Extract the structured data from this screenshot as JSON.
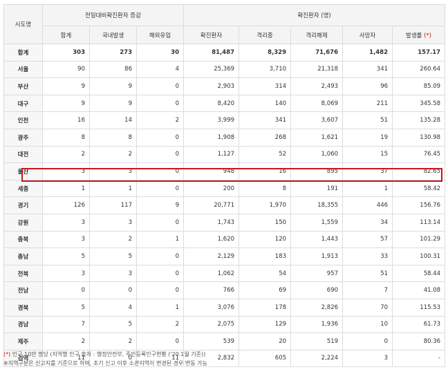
{
  "headers": {
    "region": "시도명",
    "group_daily": "전일대비확진환자 증감",
    "group_confirmed": "확진환자 (명)",
    "sub": [
      "합계",
      "국내발생",
      "해외유입",
      "확진환자",
      "격리중",
      "격리해제",
      "사망자",
      "발생률"
    ],
    "rate_mark": "(*)"
  },
  "rows": [
    {
      "region": "합계",
      "total": "303",
      "domestic": "273",
      "overseas": "30",
      "confirmed": "81,487",
      "isolated": "8,329",
      "released": "71,676",
      "deaths": "1,482",
      "rate": "157.17"
    },
    {
      "region": "서울",
      "total": "90",
      "domestic": "86",
      "overseas": "4",
      "confirmed": "25,369",
      "isolated": "3,710",
      "released": "21,318",
      "deaths": "341",
      "rate": "260.64"
    },
    {
      "region": "부산",
      "total": "9",
      "domestic": "9",
      "overseas": "0",
      "confirmed": "2,903",
      "isolated": "314",
      "released": "2,493",
      "deaths": "96",
      "rate": "85.09"
    },
    {
      "region": "대구",
      "total": "9",
      "domestic": "9",
      "overseas": "0",
      "confirmed": "8,420",
      "isolated": "140",
      "released": "8,069",
      "deaths": "211",
      "rate": "345.58"
    },
    {
      "region": "인천",
      "total": "16",
      "domestic": "14",
      "overseas": "2",
      "confirmed": "3,999",
      "isolated": "341",
      "released": "3,607",
      "deaths": "51",
      "rate": "135.28"
    },
    {
      "region": "광주",
      "total": "8",
      "domestic": "8",
      "overseas": "0",
      "confirmed": "1,908",
      "isolated": "268",
      "released": "1,621",
      "deaths": "19",
      "rate": "130.98"
    },
    {
      "region": "대전",
      "total": "2",
      "domestic": "2",
      "overseas": "0",
      "confirmed": "1,127",
      "isolated": "52",
      "released": "1,060",
      "deaths": "15",
      "rate": "76.45"
    },
    {
      "region": "울산",
      "total": "3",
      "domestic": "3",
      "overseas": "0",
      "confirmed": "948",
      "isolated": "16",
      "released": "895",
      "deaths": "37",
      "rate": "82.65"
    },
    {
      "region": "세종",
      "total": "1",
      "domestic": "1",
      "overseas": "0",
      "confirmed": "200",
      "isolated": "8",
      "released": "191",
      "deaths": "1",
      "rate": "58.42"
    },
    {
      "region": "경기",
      "total": "126",
      "domestic": "117",
      "overseas": "9",
      "confirmed": "20,771",
      "isolated": "1,970",
      "released": "18,355",
      "deaths": "446",
      "rate": "156.76"
    },
    {
      "region": "강원",
      "total": "3",
      "domestic": "3",
      "overseas": "0",
      "confirmed": "1,743",
      "isolated": "150",
      "released": "1,559",
      "deaths": "34",
      "rate": "113.14"
    },
    {
      "region": "충북",
      "total": "3",
      "domestic": "2",
      "overseas": "1",
      "confirmed": "1,620",
      "isolated": "120",
      "released": "1,443",
      "deaths": "57",
      "rate": "101.29"
    },
    {
      "region": "충남",
      "total": "5",
      "domestic": "5",
      "overseas": "0",
      "confirmed": "2,129",
      "isolated": "183",
      "released": "1,913",
      "deaths": "33",
      "rate": "100.31"
    },
    {
      "region": "전북",
      "total": "3",
      "domestic": "3",
      "overseas": "0",
      "confirmed": "1,062",
      "isolated": "54",
      "released": "957",
      "deaths": "51",
      "rate": "58.44"
    },
    {
      "region": "전남",
      "total": "0",
      "domestic": "0",
      "overseas": "0",
      "confirmed": "766",
      "isolated": "69",
      "released": "690",
      "deaths": "7",
      "rate": "41.08"
    },
    {
      "region": "경북",
      "total": "5",
      "domestic": "4",
      "overseas": "1",
      "confirmed": "3,076",
      "isolated": "178",
      "released": "2,826",
      "deaths": "70",
      "rate": "115.53"
    },
    {
      "region": "경남",
      "total": "7",
      "domestic": "5",
      "overseas": "2",
      "confirmed": "2,075",
      "isolated": "129",
      "released": "1,936",
      "deaths": "10",
      "rate": "61.73"
    },
    {
      "region": "제주",
      "total": "2",
      "domestic": "2",
      "overseas": "0",
      "confirmed": "539",
      "isolated": "20",
      "released": "519",
      "deaths": "0",
      "rate": "80.36"
    },
    {
      "region": "검역",
      "total": "11",
      "domestic": "0",
      "overseas": "11",
      "confirmed": "2,832",
      "isolated": "605",
      "released": "2,224",
      "deaths": "3",
      "rate": "-"
    }
  ],
  "highlighted_region": "세종",
  "notes": {
    "note1_mark": "(*)",
    "note1_text": " 인구 10만 명당 (지역별 인구 출처 : 행정안전부, 주민등록인구현황 ('20.1월 기준))",
    "note2_mark": "※",
    "note2_text": "지역구분은 신고지를 기준으로 하며, 초기 신고 이후 소관지역이 변경된 경우 변동 가능"
  }
}
